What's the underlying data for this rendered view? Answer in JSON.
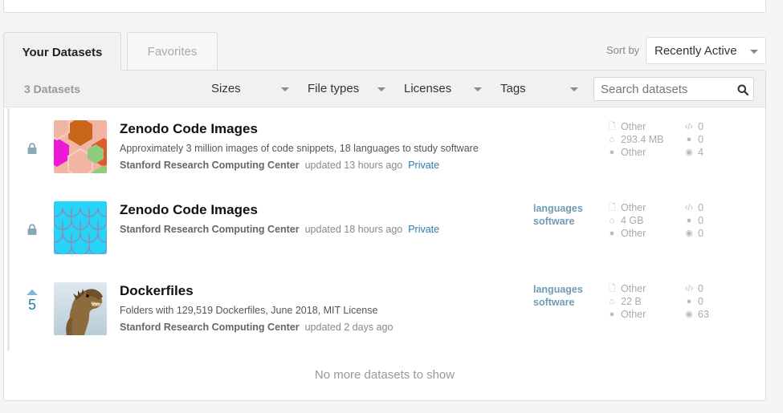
{
  "tabs": {
    "your_datasets": "Your Datasets",
    "favorites": "Favorites"
  },
  "sort": {
    "label": "Sort by",
    "value": "Recently Active"
  },
  "filters": {
    "count": "3 Datasets",
    "sizes": "Sizes",
    "file_types": "File types",
    "licenses": "Licenses",
    "tags": "Tags",
    "search_placeholder": "Search datasets"
  },
  "datasets": [
    {
      "title": "Zenodo Code Images",
      "description": "Approximately 3 million images of code snippets, 18 languages to study software",
      "owner": "Stanford Research Computing Center",
      "updated": "updated 13 hours ago",
      "visibility": "Private",
      "tags": [],
      "file_type": "Other",
      "size": "293.4 MB",
      "license": "Other",
      "kernels": "0",
      "comments": "0",
      "views": "4",
      "left_indicator": "lock-icon"
    },
    {
      "title": "Zenodo Code Images",
      "description": "",
      "owner": "Stanford Research Computing Center",
      "updated": "updated 18 hours ago",
      "visibility": "Private",
      "tags": [
        "languages",
        "software"
      ],
      "file_type": "Other",
      "size": "4 GB",
      "license": "Other",
      "kernels": "0",
      "comments": "0",
      "views": "0",
      "left_indicator": "lock-icon"
    },
    {
      "title": "Dockerfiles",
      "description": "Folders with 129,519 Dockerfiles, June 2018, MIT License",
      "owner": "Stanford Research Computing Center",
      "updated": "updated 2 days ago",
      "visibility": "",
      "tags": [
        "languages",
        "software"
      ],
      "file_type": "Other",
      "size": "22 B",
      "license": "Other",
      "kernels": "0",
      "comments": "0",
      "views": "63",
      "votes": "5",
      "left_indicator": "upvote-icon"
    }
  ],
  "footer": {
    "no_more": "No more datasets to show"
  },
  "colors": {
    "accent": "#2b7fa7",
    "tag": "#6f9bb5"
  }
}
